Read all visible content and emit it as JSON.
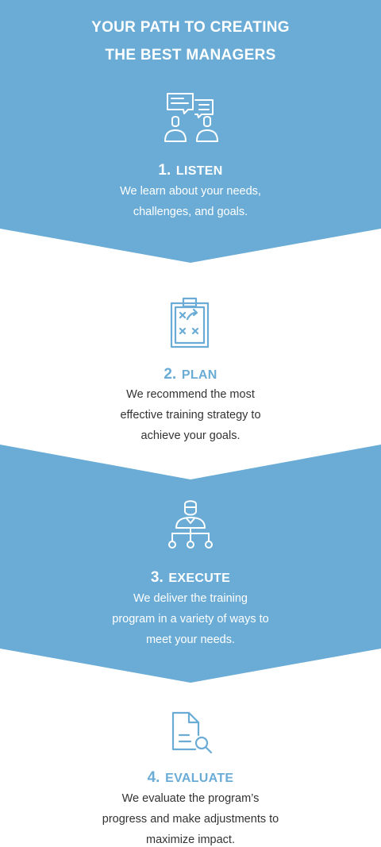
{
  "colors": {
    "band": "#6aacd6",
    "accent_text": "#6aacd6",
    "body_text": "#333333",
    "white": "#ffffff"
  },
  "header": {
    "title_line1": "YOUR PATH TO CREATING",
    "title_line2": "THE BEST MANAGERS"
  },
  "steps": [
    {
      "number": "1.",
      "label": "LISTEN",
      "icon": "conversation-people-icon",
      "description": [
        "We learn about your needs,",
        "challenges, and goals."
      ]
    },
    {
      "number": "2.",
      "label": "PLAN",
      "icon": "clipboard-strategy-icon",
      "description": [
        "We recommend the most",
        "effective training strategy to",
        "achieve your goals."
      ]
    },
    {
      "number": "3.",
      "label": "EXECUTE",
      "icon": "person-network-icon",
      "description": [
        "We deliver the training",
        "program in a variety of ways to",
        "meet your needs."
      ]
    },
    {
      "number": "4.",
      "label": "EVALUATE",
      "icon": "document-search-icon",
      "description": [
        "We evaluate the program’s",
        "progress and make adjustments to",
        "maximize impact."
      ]
    }
  ]
}
